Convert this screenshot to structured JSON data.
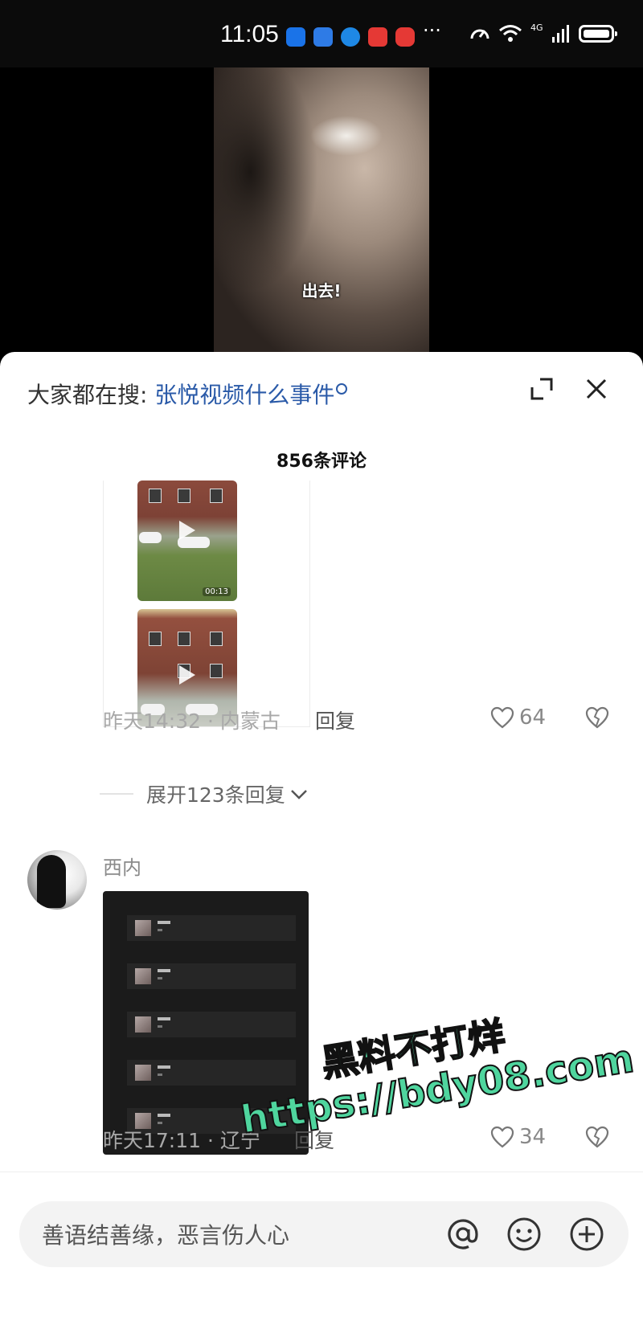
{
  "status_bar": {
    "time": "11:05",
    "app_icons": [
      {
        "name": "message-app-icon",
        "color": "#1a73e8"
      },
      {
        "name": "signal-app-icon",
        "color": "#2e7be6"
      },
      {
        "name": "browser-app-icon",
        "color": "#1e88e5"
      },
      {
        "name": "shop-app-icon",
        "color": "#e53935"
      },
      {
        "name": "red-app-icon",
        "color": "#e53935"
      }
    ],
    "more": "···",
    "network": "4G"
  },
  "video": {
    "subtitle": "出去!"
  },
  "comments_panel": {
    "search_prefix": "大家都在搜:",
    "search_term": "张悦视频什么事件",
    "comment_count_label": "856条评论",
    "comments": [
      {
        "video_duration": "00:13",
        "meta": "昨天14:32 · 内蒙古",
        "reply_label": "回复",
        "likes": "64",
        "expand_replies_label": "展开123条回复"
      },
      {
        "username": "西内",
        "meta": "昨天17:11 · 辽宁",
        "reply_label": "回复",
        "likes": "34"
      }
    ]
  },
  "watermark": {
    "line1": "黑料不打烊",
    "line2": "https://bdy08.com"
  },
  "input_bar": {
    "placeholder": "善语结善缘，恶言伤人心"
  },
  "colors": {
    "search_term": "#2a5aa8",
    "watermark": "#4fd59e",
    "sheet_bg": "#ffffff"
  }
}
